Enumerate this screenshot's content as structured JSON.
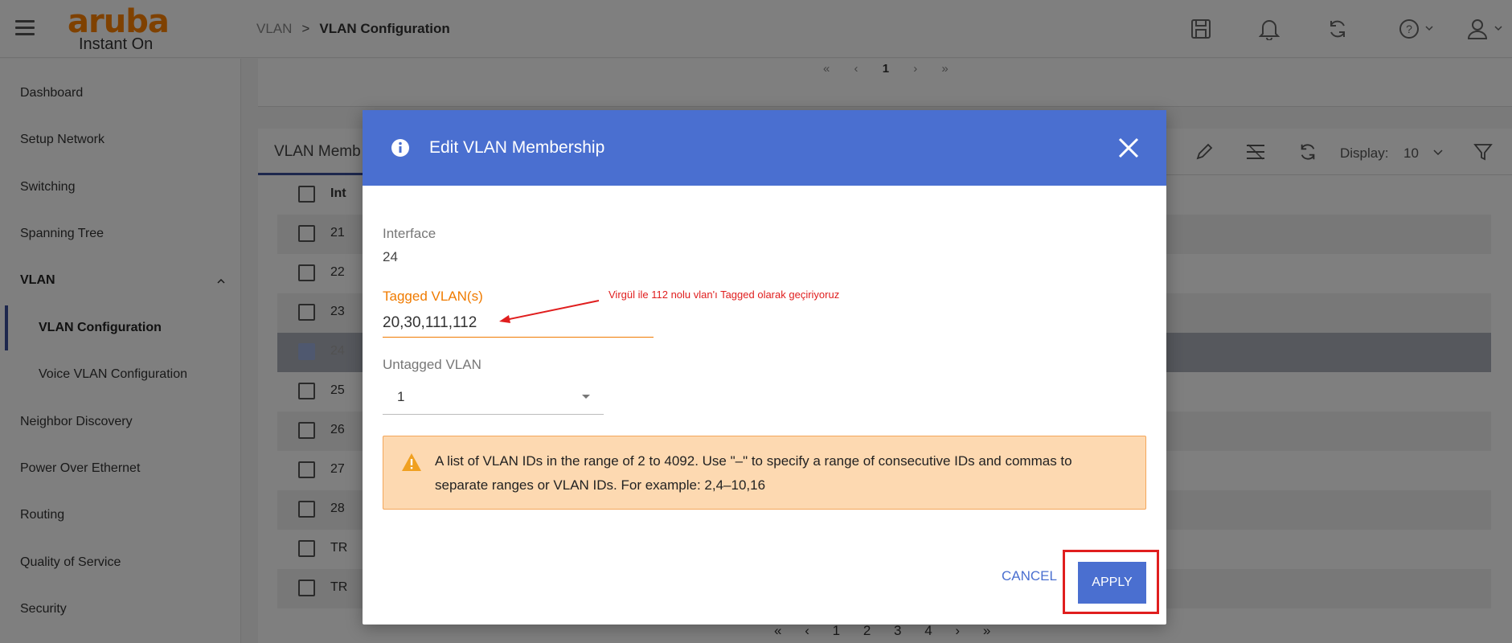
{
  "header": {
    "logo_main": "aruba",
    "logo_sub": "Instant On",
    "breadcrumb_parent": "VLAN",
    "breadcrumb_sep": ">",
    "breadcrumb_current": "VLAN Configuration"
  },
  "sidebar": {
    "items": [
      {
        "label": "Dashboard"
      },
      {
        "label": "Setup Network"
      },
      {
        "label": "Switching"
      },
      {
        "label": "Spanning Tree"
      },
      {
        "label": "VLAN"
      },
      {
        "label": "VLAN Configuration"
      },
      {
        "label": "Voice VLAN Configuration"
      },
      {
        "label": "Neighbor Discovery"
      },
      {
        "label": "Power Over Ethernet"
      },
      {
        "label": "Routing"
      },
      {
        "label": "Quality of Service"
      },
      {
        "label": "Security"
      }
    ]
  },
  "top_pager": {
    "first": "«",
    "prev": "‹",
    "page": "1",
    "next": "›",
    "last": "»"
  },
  "table": {
    "tab_label": "VLAN Memb",
    "header_col": "Int",
    "display_label": "Display:",
    "display_value": "10",
    "rows": [
      {
        "cell": "21"
      },
      {
        "cell": "22"
      },
      {
        "cell": "23"
      },
      {
        "cell": "24",
        "checked": true
      },
      {
        "cell": "25"
      },
      {
        "cell": "26"
      },
      {
        "cell": "27"
      },
      {
        "cell": "28"
      },
      {
        "cell": "TR"
      },
      {
        "cell": "TR"
      }
    ]
  },
  "bottom_pager": [
    "«",
    "‹",
    "1",
    "2",
    "3",
    "4",
    "›",
    "»"
  ],
  "modal": {
    "title": "Edit VLAN Membership",
    "interface_label": "Interface",
    "interface_value": "24",
    "tagged_label": "Tagged VLAN(s)",
    "tagged_value": "20,30,111,112",
    "untagged_label": "Untagged VLAN",
    "untagged_value": "1",
    "warning_text": "A list of VLAN IDs in the range of 2 to 4092. Use \"–\" to specify a range of consecutive IDs and commas to separate ranges or VLAN IDs. For example: 2,4–10,16",
    "cancel_label": "CANCEL",
    "apply_label": "APPLY"
  },
  "annotation": {
    "text": "Virgül ile 112 nolu vlan'ı Tagged olarak geçiriyoruz"
  },
  "colors": {
    "accent": "#4a6fd0",
    "brand_orange": "#ff8300",
    "warning_bg": "#fdd9b1",
    "annotation_red": "#e01e1e",
    "nav_active": "#3a4f9a"
  },
  "icons": [
    "menu-icon",
    "save-icon",
    "bell-icon",
    "refresh-icon",
    "help-icon",
    "user-icon",
    "info-icon",
    "close-icon",
    "warning-icon",
    "edit-icon",
    "filter-icon"
  ]
}
